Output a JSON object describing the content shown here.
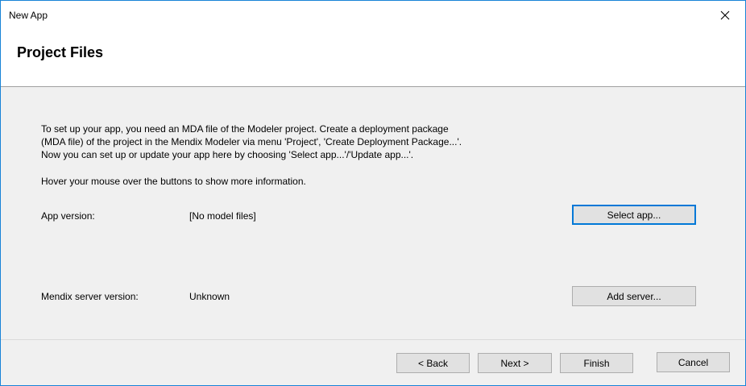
{
  "window": {
    "title": "New App",
    "close_icon": "close-icon"
  },
  "header": {
    "title": "Project Files"
  },
  "intro": {
    "lines": "To set up your app, you need an MDA file of the Modeler project. Create a deployment package\n(MDA file) of the project in the Mendix Modeler via menu 'Project', 'Create Deployment Package...'.\nNow you can set up or update your app here by choosing 'Select app...'/'Update app...'.",
    "hover_hint": "Hover your mouse over the buttons to show more information."
  },
  "app_version": {
    "label": "App version:",
    "value": "[No model files]",
    "button": "Select app..."
  },
  "server_version": {
    "label": "Mendix server version:",
    "value": "Unknown",
    "button": "Add server..."
  },
  "footer": {
    "back": "< Back",
    "next": "Next >",
    "finish": "Finish",
    "cancel": "Cancel"
  }
}
